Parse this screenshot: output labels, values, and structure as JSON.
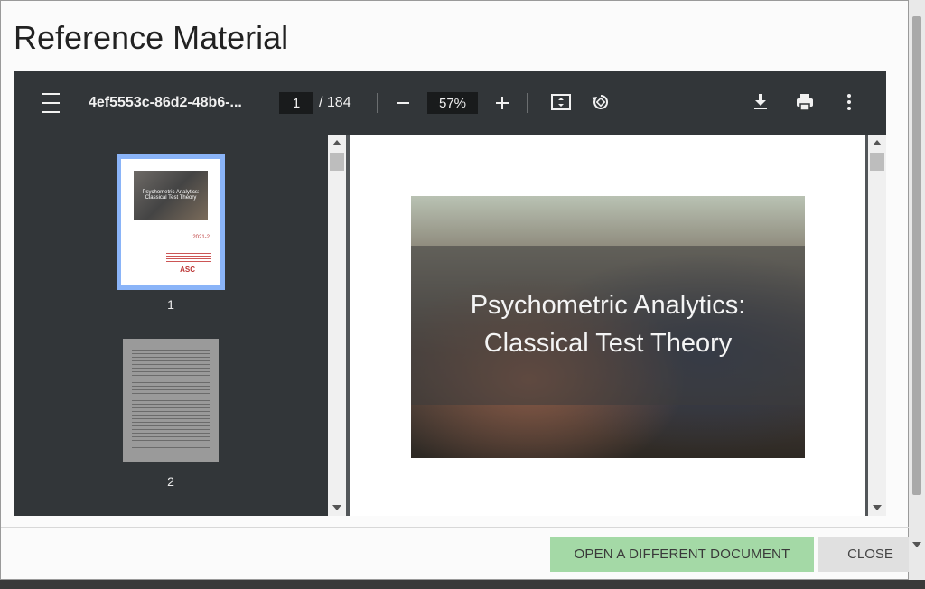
{
  "dialog": {
    "title": "Reference Material",
    "buttons": {
      "open_label": "OPEN A DIFFERENT DOCUMENT",
      "close_label": "CLOSE"
    }
  },
  "viewer": {
    "file_name": "4ef5553c-86d2-48b6-...",
    "current_page": "1",
    "total_pages": "/ 184",
    "zoom": "57%",
    "thumbnails": [
      {
        "label": "1"
      },
      {
        "label": "2"
      }
    ],
    "cover": {
      "title": "Psychometric Analytics:\nClassical Test Theory"
    },
    "thumb1_text": {
      "title": "Psychometric Analytics: Classical Test Theory",
      "code": "2021-2",
      "logo": "ASC"
    }
  },
  "colors": {
    "toolbar": "#323639",
    "open_button": "#a4d9a6",
    "close_button": "#e0e0e0",
    "thumbnail_selected": "#8ab4f8"
  }
}
